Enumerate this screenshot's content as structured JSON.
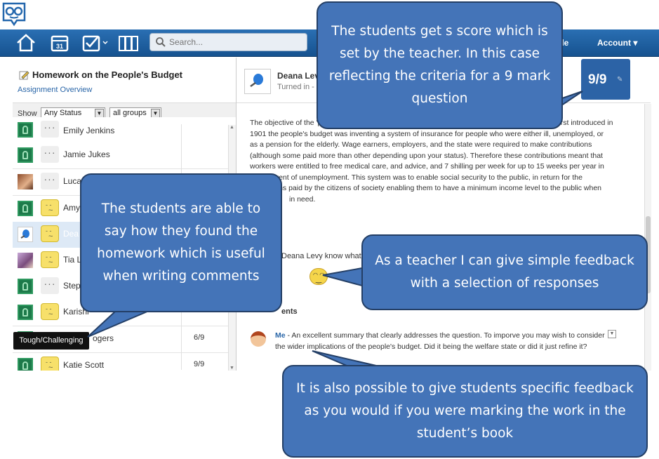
{
  "nav": {
    "search_placeholder": "Search...",
    "profile_label": "file",
    "account_label": "Account ▾"
  },
  "left_panel": {
    "title": "Homework on the People's Budget",
    "subtitle": "Assignment Overview",
    "show_label": "Show",
    "status_filter": "Any Status",
    "group_filter": "all groups",
    "students": [
      {
        "name": "Emily Jenkins",
        "score": ""
      },
      {
        "name": "Jamie Jukes",
        "score": ""
      },
      {
        "name": "Luca L",
        "score": ""
      },
      {
        "name": "Amy",
        "score": ""
      },
      {
        "name": "Dea",
        "score": ""
      },
      {
        "name": "Tia L",
        "score": ""
      },
      {
        "name": "Step",
        "score": ""
      },
      {
        "name": "Karishi",
        "score": ""
      },
      {
        "name": "ogers",
        "score": "6/9"
      },
      {
        "name": "Katie Scott",
        "score": "9/9"
      }
    ],
    "tooltip": "Tough/Challenging"
  },
  "submission": {
    "student_name": "Deana Levy",
    "turned_in": "Turned in -",
    "score": "9/9",
    "essay_lines": [
      "The objective of the 'p",
      "1901 the people's budget was inventing a system of insurance for people who were either ill, unemployed, or",
      "as a pension for the elderly. Wage earners, employers, and the state were required to make contributions",
      "(although some paid more than other depending upon your status). Therefore these contributions meant that",
      "workers were entitled to free medical care, and advice, and 7 shilling per week for up to 15 weeks per year in",
      "event of unemployment. This system was to enable social security to the public, in return for the",
      "tions paid by the citizens of society enabling them to have a minimum income level to the public when",
      "in need."
    ],
    "essay_line1_tail": "First introduced in",
    "feedback_prompt": "Deana Levy know what",
    "comments_heading": "ents",
    "comment_author": "Me",
    "comment_text": " - An excellent summary that clearly addresses the question. To imporve you may wish to consider the wider implications of the people's budget. Did it being the welfare state or did it just refine it?"
  },
  "callouts": {
    "score": "The students get s score which is set by the teacher. In this case reflecting the criteria for a 9 mark question",
    "students": "The students are able to say how they found the homework which is useful when writing comments",
    "teacher": "As a teacher I can give simple feedback with a selection of responses",
    "specific": "It is also possible to give students specific feedback as you would if you were marking the work in the student’s book"
  },
  "colors": {
    "callout_fill": "#4474b8",
    "callout_border": "#243f66",
    "navbar": "#1f60a3",
    "score_box": "#2c63a6"
  }
}
